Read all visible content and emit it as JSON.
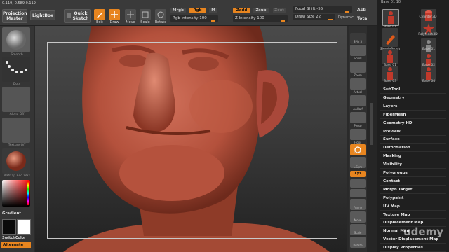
{
  "topbar": {
    "coords": "0.119,-0.589,0.119",
    "projection_master": "Projection Master",
    "lightbox": "LightBox",
    "quick_sketch": "Quick Sketch",
    "edit": "Edit",
    "draw": "Draw",
    "move": "Move",
    "scale": "Scale",
    "rotate": "Rotate",
    "mrgb": "Mrgb",
    "rgb": "Rgb",
    "m": "M",
    "zadd": "Zadd",
    "zsub": "Zsub",
    "zcut": "Zcut",
    "rgb_intensity": "Rgb Intensity 100",
    "z_intensity": "Z Intensity 100",
    "focal_shift": "Focal Shift -55",
    "draw_size": "Draw Size 22",
    "dynamic": "Dynamic",
    "active": "Acti",
    "total": "Tota"
  },
  "leftpanel": {
    "tiles": [
      "Smooth",
      "Dots",
      "Alpha Off",
      "Texture Off",
      "MatCap Red Wax"
    ],
    "gradient": "Gradient",
    "switchcolor": "SwitchColor",
    "alternate": "Alternate"
  },
  "righttools": {
    "items": [
      "SPix 3",
      "Scroll",
      "Zoom",
      "Actual",
      "AAHalf",
      "Persp",
      "Floor",
      "Local",
      "L.Sym",
      "Xyz",
      "",
      "",
      "Frame",
      "Move",
      "Scale",
      "Rotate"
    ]
  },
  "rightpanel": {
    "top_label": "Base 01 10",
    "thumbs": [
      {
        "label": "Base 01",
        "color": "#c0392b"
      },
      {
        "label": "Cylinder3D",
        "color": "#c0392b"
      },
      {
        "label": "",
        "color": "#444"
      },
      {
        "label": "PolyMesh3D",
        "color": "#c0392b"
      },
      {
        "label": "SimpleBrush",
        "color": "#e05a1a"
      },
      {
        "label": "Base 01",
        "color": "#6a6a6a"
      },
      {
        "label": "Base 01",
        "color": "#555"
      },
      {
        "label": "Base 02",
        "color": "#555"
      },
      {
        "label": "Base 03",
        "color": "#555"
      },
      {
        "label": "Base 04",
        "color": "#555"
      }
    ],
    "menu": [
      "SubTool",
      "Geometry",
      "Layers",
      "FiberMesh",
      "Geometry HD",
      "Preview",
      "Surface",
      "Deformation",
      "Masking",
      "Visibility",
      "Polygroups",
      "Contact",
      "Morph Target",
      "Polypaint",
      "UV Map",
      "Texture Map",
      "Displacement Map",
      "Normal Map",
      "Vector Displacement Map",
      "Display Properties"
    ]
  },
  "watermark": "udemy",
  "colors": {
    "accent": "#e8851f",
    "clay": "#b4513c"
  }
}
